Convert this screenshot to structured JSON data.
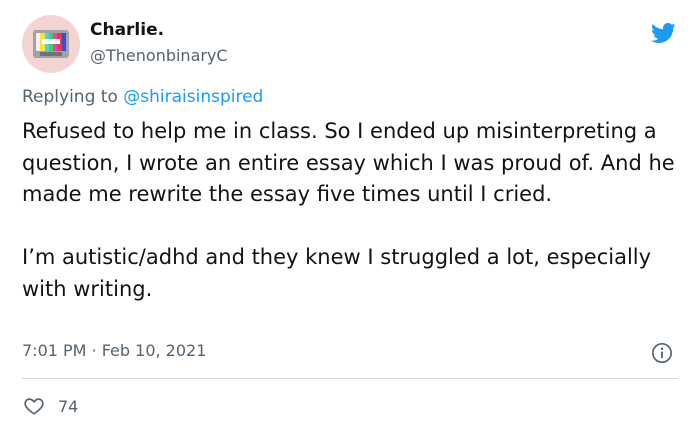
{
  "author": {
    "display_name": "Charlie.",
    "handle": "@ThenonbinaryC",
    "avatar_icon": "retro-tv-avatar"
  },
  "reply": {
    "prefix": "Replying to ",
    "mention": "@shiraisinspired"
  },
  "tweet": {
    "paragraphs": [
      "Refused to help me in class. So I ended up misinterpreting a question, I wrote an entire essay which I was proud of. And he made me rewrite the essay five times until I cried.",
      "I’m autistic/adhd and they knew I struggled a lot, especially with writing."
    ]
  },
  "meta": {
    "timestamp": "7:01 PM · Feb 10, 2021"
  },
  "actions": {
    "like_count": "74"
  },
  "icons": {
    "brand": "twitter-bird-icon",
    "info": "info-icon",
    "like": "heart-icon"
  },
  "colors": {
    "brand_blue": "#1d9bf0",
    "secondary_text": "#536471",
    "primary_text": "#0f1419",
    "divider": "#cfd9de"
  }
}
